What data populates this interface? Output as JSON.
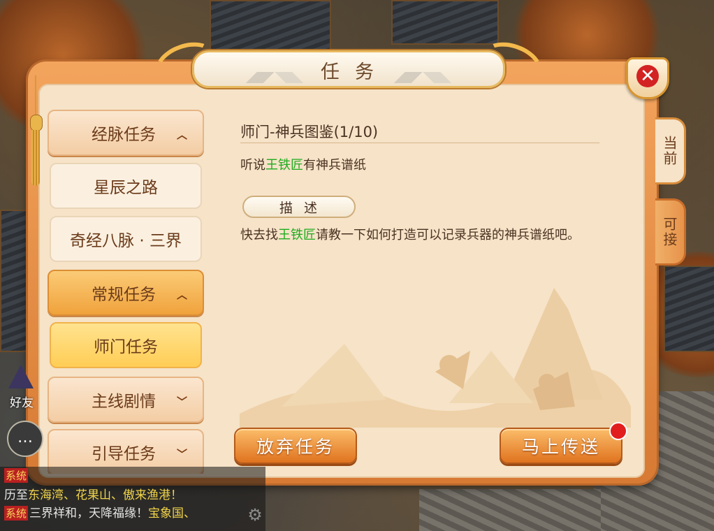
{
  "window": {
    "title": "任务",
    "close_icon": "close-icon",
    "accent": "#e0731f"
  },
  "nav": {
    "items": [
      {
        "label": "经脉任务",
        "type": "category",
        "chevron": "^"
      },
      {
        "label": "星辰之路",
        "type": "sub"
      },
      {
        "label": "奇经八脉 · 三界",
        "type": "sub"
      },
      {
        "label": "常规任务",
        "type": "category",
        "chevron": "^",
        "active": true
      },
      {
        "label": "师门任务",
        "type": "sub",
        "active": true
      },
      {
        "label": "主线剧情",
        "type": "category",
        "chevron": "⌄"
      },
      {
        "label": "引导任务",
        "type": "category",
        "chevron": "⌄"
      }
    ]
  },
  "quest": {
    "title": "师门-神兵图鉴(1/10)",
    "summary_pre": "听说",
    "summary_npc": "王铁匠",
    "summary_post": "有神兵谱纸",
    "desc_label": "描述",
    "desc_pre": "快去找",
    "desc_npc": "王铁匠",
    "desc_post": "请教一下如何打造可以记录兵器的神兵谱纸吧。"
  },
  "buttons": {
    "abandon": "放弃任务",
    "teleport": "马上传送"
  },
  "tabs": {
    "current": "当前",
    "available": "可接"
  },
  "hud": {
    "friend_label": "好友",
    "chat_icon": "chat-icon",
    "chat": [
      {
        "tag": "系统",
        "segments": []
      },
      {
        "tag": "",
        "text": "历至",
        "hl": "东海湾、花果山、傲来渔港！"
      },
      {
        "tag": "系统",
        "text": "三界祥和，天降福缘！",
        "hl": "宝象国、"
      }
    ]
  }
}
